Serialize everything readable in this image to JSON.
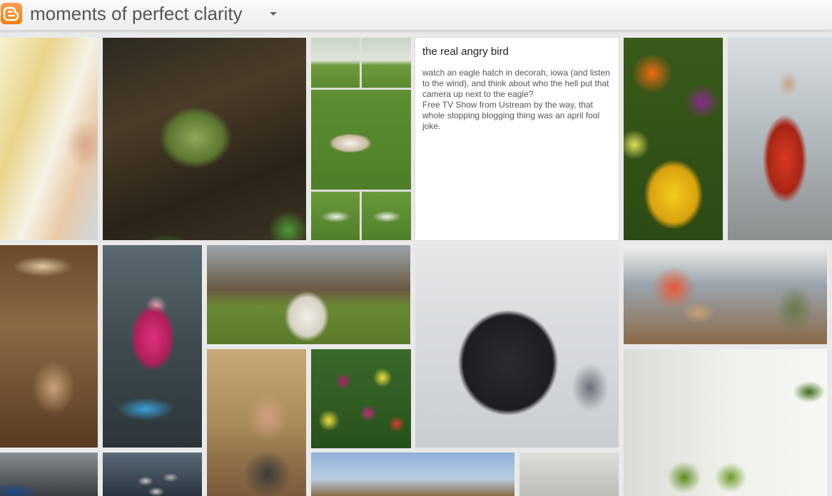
{
  "blog": {
    "title": "moments of perfect clarity",
    "logo_icon": "blogger-logo-icon",
    "menu_icon": "caret-down-icon"
  },
  "featured_post": {
    "title": "the real angry bird",
    "lines": [
      "watch an eagle hatch in decorah, iowa (and listen to the wind), and think about who the hell put that camera up next to the eagle?",
      "Free TV Show from Ustream by the way, that whole stopping blogging thing was an april fool joke."
    ]
  },
  "photos": [
    {
      "subject": "blonde woman face"
    },
    {
      "subject": "green bulb sprout"
    },
    {
      "subject": "cat grass collage"
    },
    {
      "subject": "colorful tulips"
    },
    {
      "subject": "woman red coat window reflection"
    },
    {
      "subject": "people on tram"
    },
    {
      "subject": "felt pig and stones"
    },
    {
      "subject": "white tent in field"
    },
    {
      "subject": "brownie flash camera"
    },
    {
      "subject": "two women at cafe"
    },
    {
      "subject": "boy in sandbox"
    },
    {
      "subject": "tulip bouquet"
    },
    {
      "subject": "lemon tree window"
    },
    {
      "subject": "blue object"
    },
    {
      "subject": "stones in bowl"
    },
    {
      "subject": "bare trees sky"
    },
    {
      "subject": "white chairs"
    }
  ]
}
